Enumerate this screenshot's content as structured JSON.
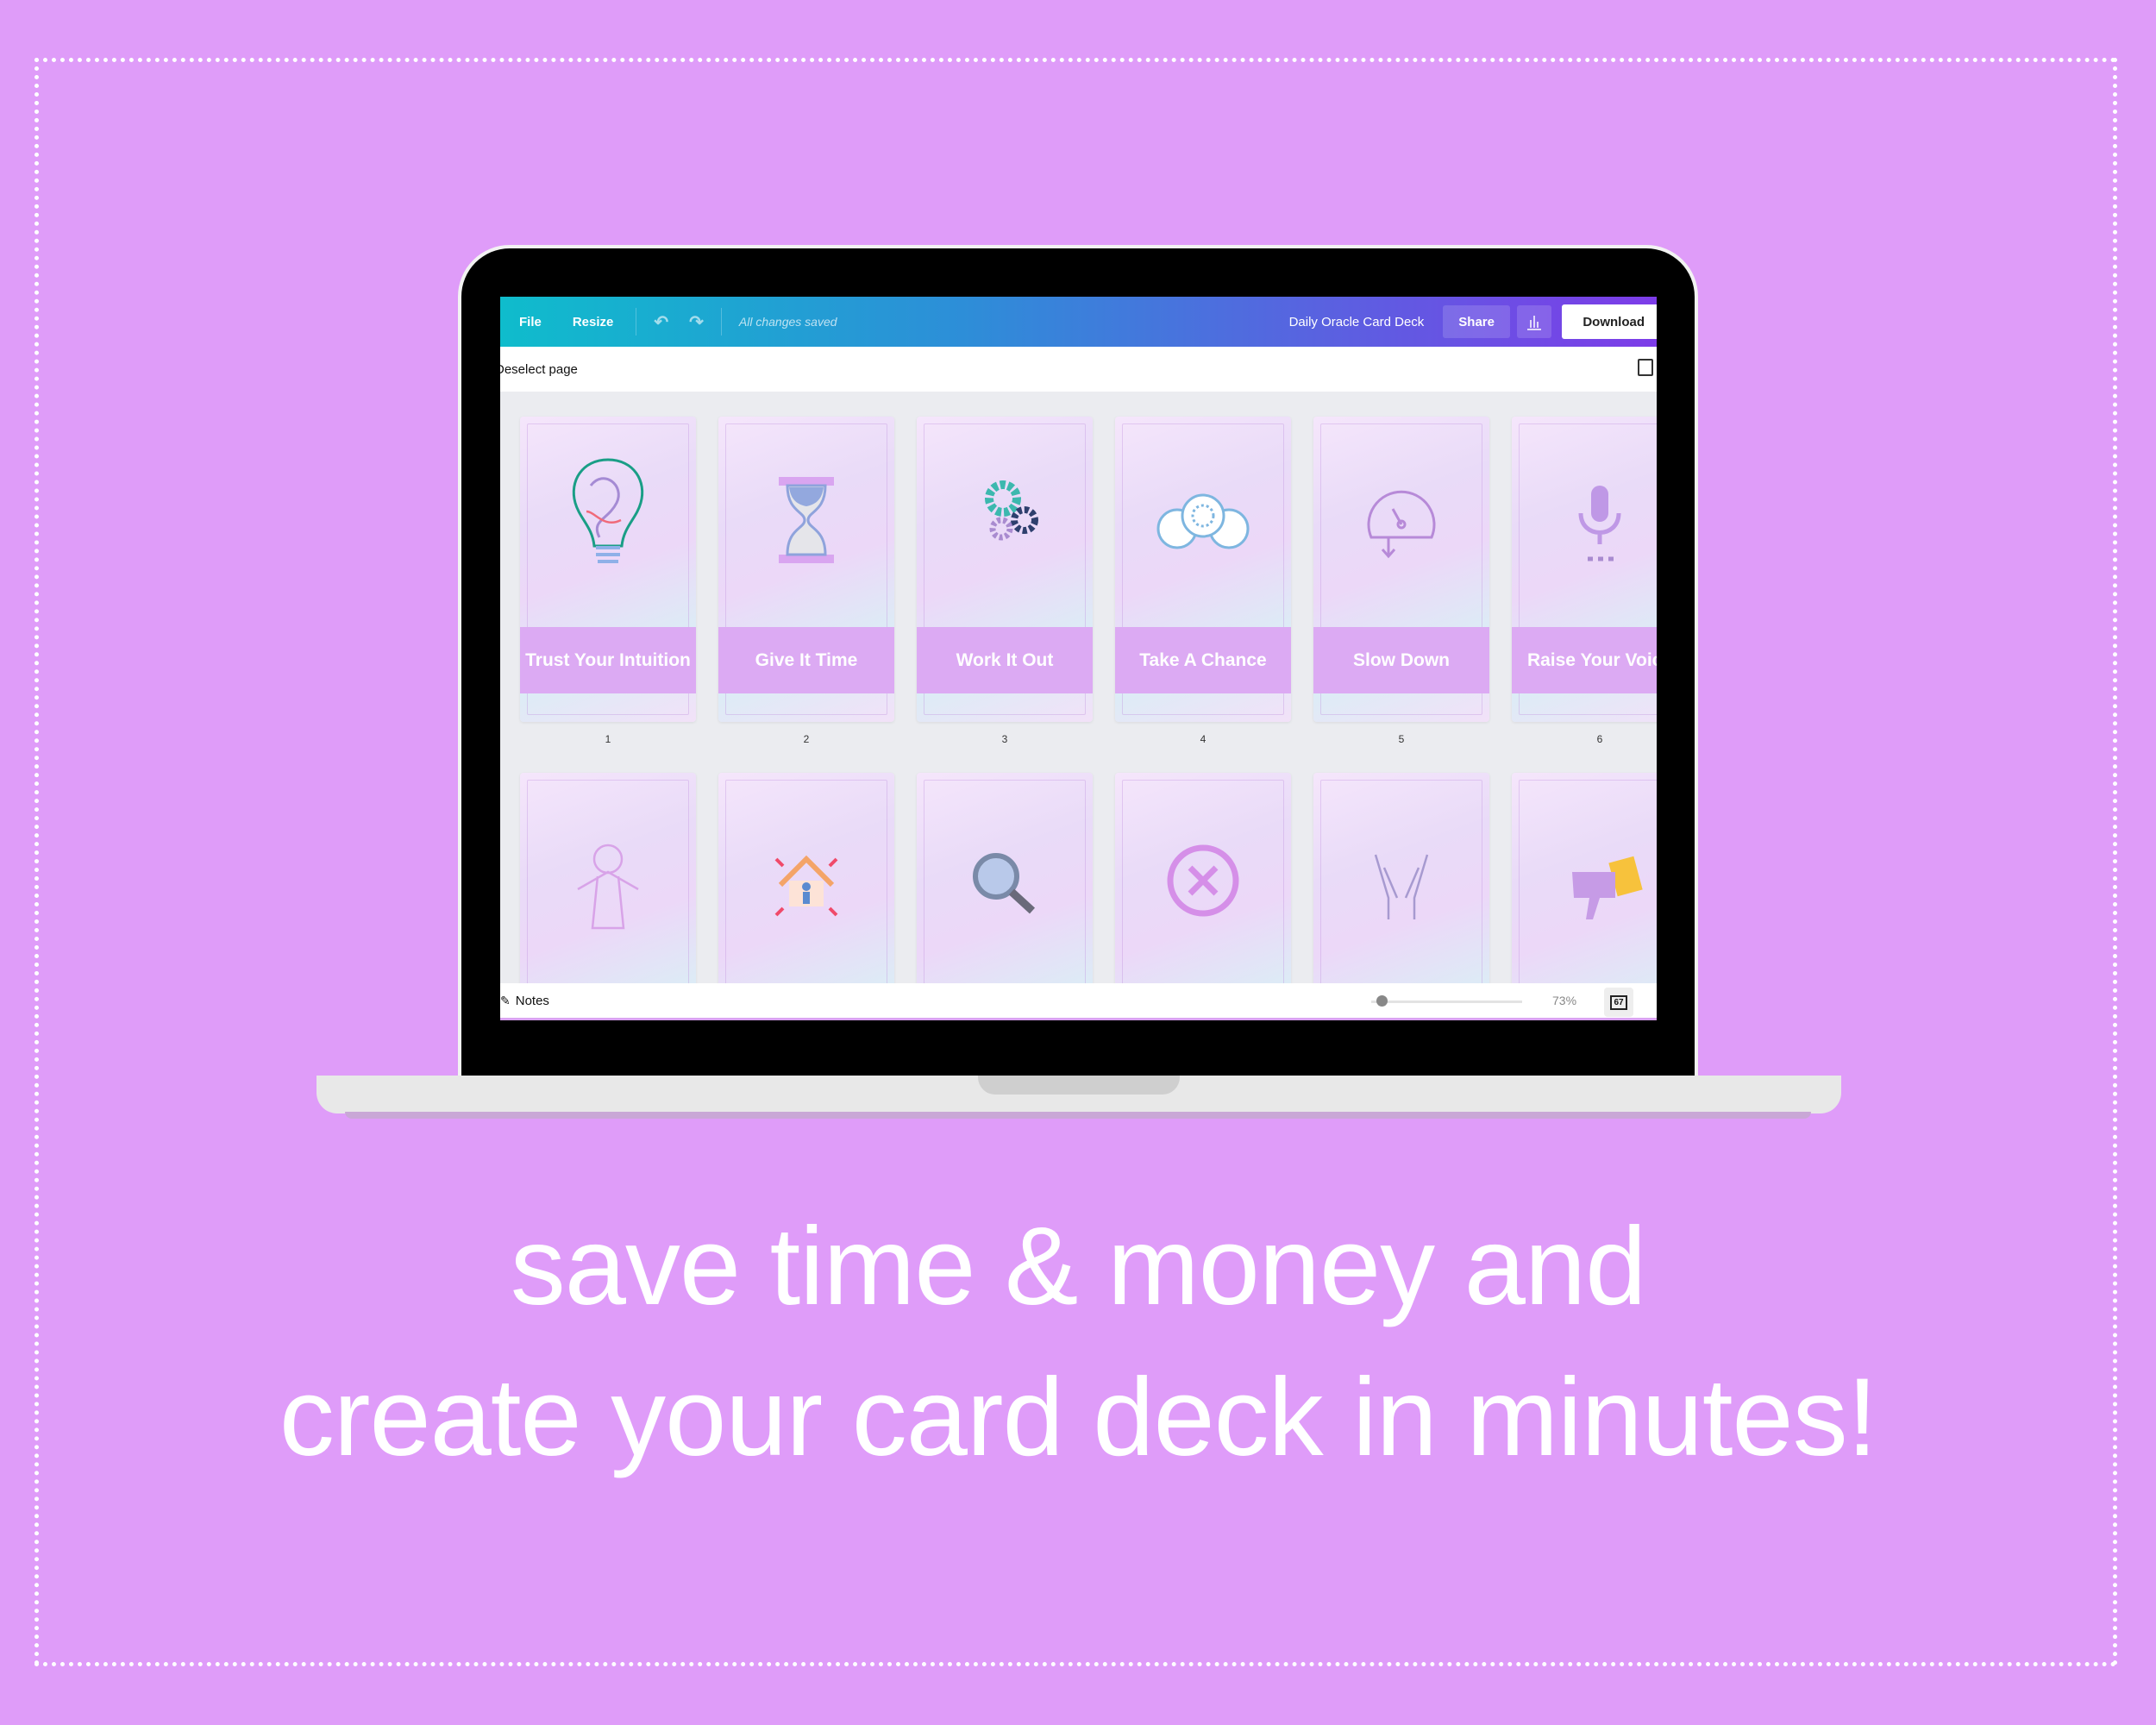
{
  "toolbar": {
    "file": "File",
    "resize": "Resize",
    "saved": "All changes saved",
    "title": "Daily Oracle Card Deck",
    "share": "Share",
    "download": "Download"
  },
  "subbar": {
    "deselect": "Deselect page"
  },
  "cards": [
    {
      "label": "Trust Your Intuition",
      "page": "1",
      "icon": "lightbulb-icon"
    },
    {
      "label": "Give It Time",
      "page": "2",
      "icon": "hourglass-icon"
    },
    {
      "label": "Work It Out",
      "page": "3",
      "icon": "gears-icon"
    },
    {
      "label": "Take A Chance",
      "page": "4",
      "icon": "poker-chips-icon"
    },
    {
      "label": "Slow Down",
      "page": "5",
      "icon": "speedometer-icon"
    },
    {
      "label": "Raise Your Voice",
      "page": "6",
      "icon": "microphone-icon"
    }
  ],
  "cards_row2": [
    {
      "icon": "jesus-figure-icon"
    },
    {
      "icon": "home-icon"
    },
    {
      "icon": "magnifier-icon"
    },
    {
      "icon": "cancel-circle-icon"
    },
    {
      "icon": "praying-hands-icon"
    },
    {
      "icon": "thumbs-down-icon"
    }
  ],
  "bottombar": {
    "notes": "Notes",
    "zoom": "73%",
    "zoom_level_percent": 73,
    "page_count": "67"
  },
  "tagline": {
    "line1": "save time & money and",
    "line2": "create your card deck in minutes!"
  },
  "colors": {
    "background": "#df9cf9",
    "card_band": "#dcaaf3",
    "toolbar_start": "#0fbccc",
    "toolbar_end": "#7d3ce8"
  }
}
